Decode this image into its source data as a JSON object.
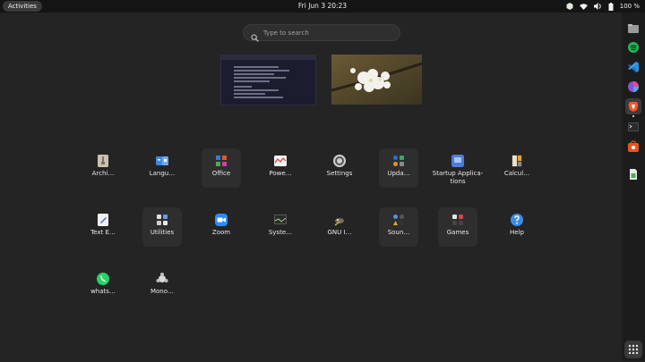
{
  "topbar": {
    "activities_label": "Activities",
    "clock": "Fri Jun 3  20:23",
    "battery": "100 %",
    "icons": [
      "tray-extension-icon",
      "wifi-icon",
      "volume-icon",
      "battery-icon"
    ]
  },
  "search": {
    "placeholder": "Type to search"
  },
  "windows": [
    "text-editor-window",
    "cherry-blossom-image-window"
  ],
  "apps": [
    {
      "label": "Archi…",
      "icon": "archive-icon"
    },
    {
      "label": "Langu…",
      "icon": "language-icon"
    },
    {
      "label": "Office",
      "icon": "office-folder-icon"
    },
    {
      "label": "Powe…",
      "icon": "power-statistics-icon"
    },
    {
      "label": "Settings",
      "icon": "settings-icon"
    },
    {
      "label": "Upda…",
      "icon": "updates-folder-icon"
    },
    {
      "label": "Startup Applica­tions",
      "icon": "startup-apps-icon"
    },
    {
      "label": "Calcul…",
      "icon": "calculator-icon"
    },
    {
      "label": "Text E…",
      "icon": "text-editor-icon"
    },
    {
      "label": "Utilities",
      "icon": "utilities-folder-icon"
    },
    {
      "label": "Zoom",
      "icon": "zoom-icon"
    },
    {
      "label": "Syste…",
      "icon": "system-monitor-icon"
    },
    {
      "label": "GNU I…",
      "icon": "gimp-icon"
    },
    {
      "label": "Soun…",
      "icon": "sound-folder-icon"
    },
    {
      "label": "Games",
      "icon": "games-folder-icon"
    },
    {
      "label": "Help",
      "icon": "help-icon"
    },
    {
      "label": "whats…",
      "icon": "whatsapp-icon"
    },
    {
      "label": "Mono…",
      "icon": "mono-icon"
    }
  ],
  "dock": [
    "files-icon",
    "spotify-icon",
    "vscode-icon",
    "color-picker-icon",
    "brave-icon",
    "terminal-icon",
    "software-store-icon",
    "libreoffice-icon",
    "show-apps-icon"
  ],
  "colors": {
    "background": "#242424",
    "topbar": "#141414",
    "dock": "#1c1c1c"
  }
}
